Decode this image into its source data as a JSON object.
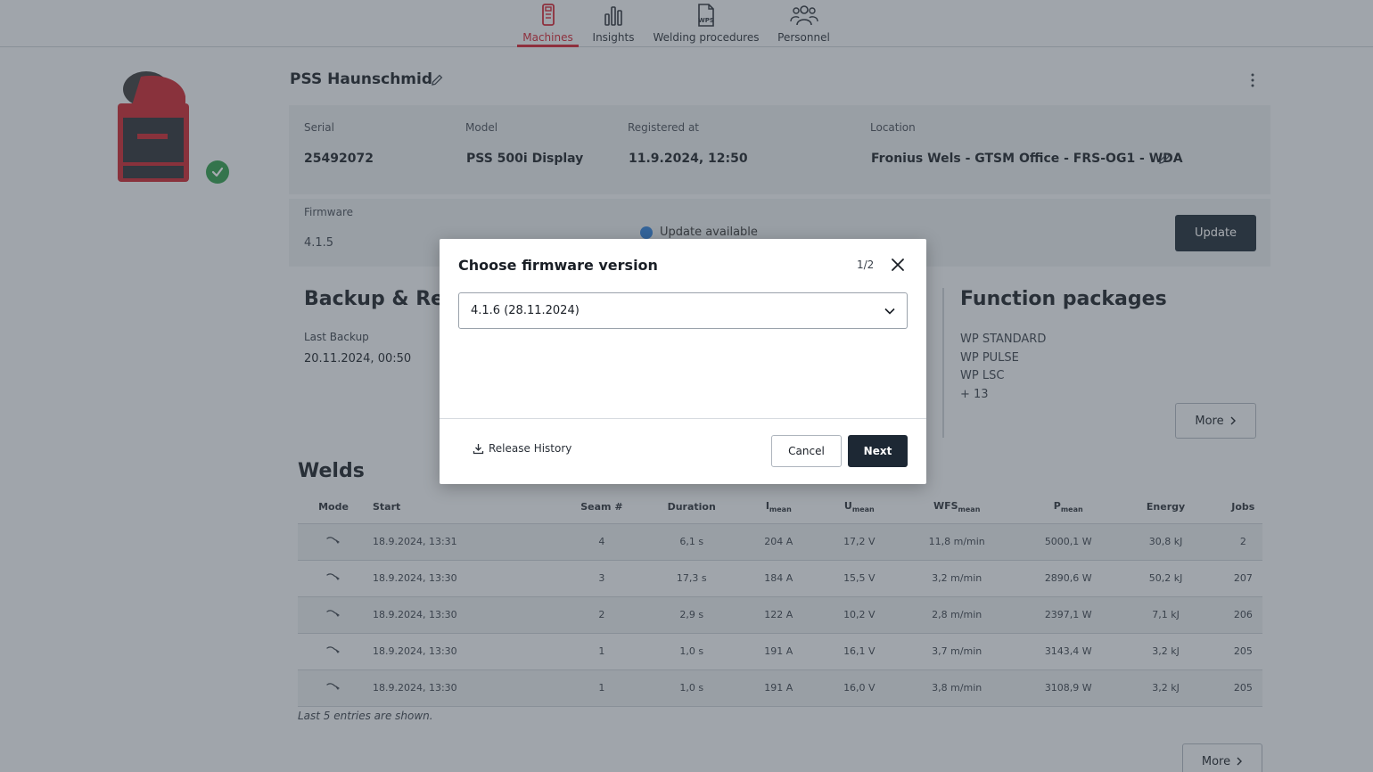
{
  "nav": {
    "items": [
      {
        "label": "Machines",
        "icon": "machine-icon",
        "active": true
      },
      {
        "label": "Insights",
        "icon": "bar-chart-icon",
        "active": false
      },
      {
        "label": "Welding procedures",
        "icon": "wps-document-icon",
        "icon_text": "WPS",
        "active": false
      },
      {
        "label": "Personnel",
        "icon": "people-icon",
        "active": false
      }
    ],
    "accent": "#d11f2f"
  },
  "machine": {
    "name": "PSS Haunschmid",
    "status_color": "#2e9b4a",
    "info": {
      "serial_label": "Serial",
      "serial": "25492072",
      "model_label": "Model",
      "model": "PSS 500i Display",
      "registered_label": "Registered at",
      "registered": "11.9.2024, 12:50",
      "location_label": "Location",
      "location": "Fronius Wels - GTSM Office - FRS-OG1 - WDA"
    },
    "firmware": {
      "label": "Firmware",
      "version": "4.1.5",
      "update_available": "Update available",
      "update_button": "Update"
    }
  },
  "backup": {
    "title": "Backup & Res",
    "last_backup_label": "Last Backup",
    "last_backup": "20.11.2024, 00:50"
  },
  "function_packages": {
    "title": "Function packages",
    "items": [
      "WP STANDARD",
      "WP PULSE",
      "WP LSC"
    ],
    "more_count": "+ 13",
    "more_button": "More"
  },
  "welds": {
    "title": "Welds",
    "headers": {
      "mode": "Mode",
      "start": "Start",
      "seam": "Seam #",
      "duration": "Duration",
      "i_mean_main": "I",
      "i_mean_sub": "mean",
      "u_mean_main": "U",
      "u_mean_sub": "mean",
      "wfs_mean_main": "WFS",
      "wfs_mean_sub": "mean",
      "p_mean_main": "P",
      "p_mean_sub": "mean",
      "energy": "Energy",
      "jobs": "Jobs"
    },
    "rows": [
      {
        "start": "18.9.2024, 13:31",
        "seam": "4",
        "duration": "6,1 s",
        "i": "204 A",
        "u": "17,2 V",
        "wfs": "11,8 m/min",
        "p": "5000,1 W",
        "energy": "30,8 kJ",
        "jobs": "2"
      },
      {
        "start": "18.9.2024, 13:30",
        "seam": "3",
        "duration": "17,3 s",
        "i": "184 A",
        "u": "15,5 V",
        "wfs": "3,2 m/min",
        "p": "2890,6 W",
        "energy": "50,2 kJ",
        "jobs": "207"
      },
      {
        "start": "18.9.2024, 13:30",
        "seam": "2",
        "duration": "2,9 s",
        "i": "122 A",
        "u": "10,2 V",
        "wfs": "2,8 m/min",
        "p": "2397,1 W",
        "energy": "7,1 kJ",
        "jobs": "206"
      },
      {
        "start": "18.9.2024, 13:30",
        "seam": "1",
        "duration": "1,0 s",
        "i": "191 A",
        "u": "16,1 V",
        "wfs": "3,7 m/min",
        "p": "3143,4 W",
        "energy": "3,2 kJ",
        "jobs": "205"
      },
      {
        "start": "18.9.2024, 13:30",
        "seam": "1",
        "duration": "1,0 s",
        "i": "191 A",
        "u": "16,0 V",
        "wfs": "3,8 m/min",
        "p": "3108,9 W",
        "energy": "3,2 kJ",
        "jobs": "205"
      }
    ],
    "footnote": "Last 5 entries are shown.",
    "more_button": "More"
  },
  "modal": {
    "title": "Choose firmware version",
    "step": "1/2",
    "selected_version": "4.1.6 (28.11.2024)",
    "release_history": "Release History",
    "cancel": "Cancel",
    "next": "Next"
  }
}
